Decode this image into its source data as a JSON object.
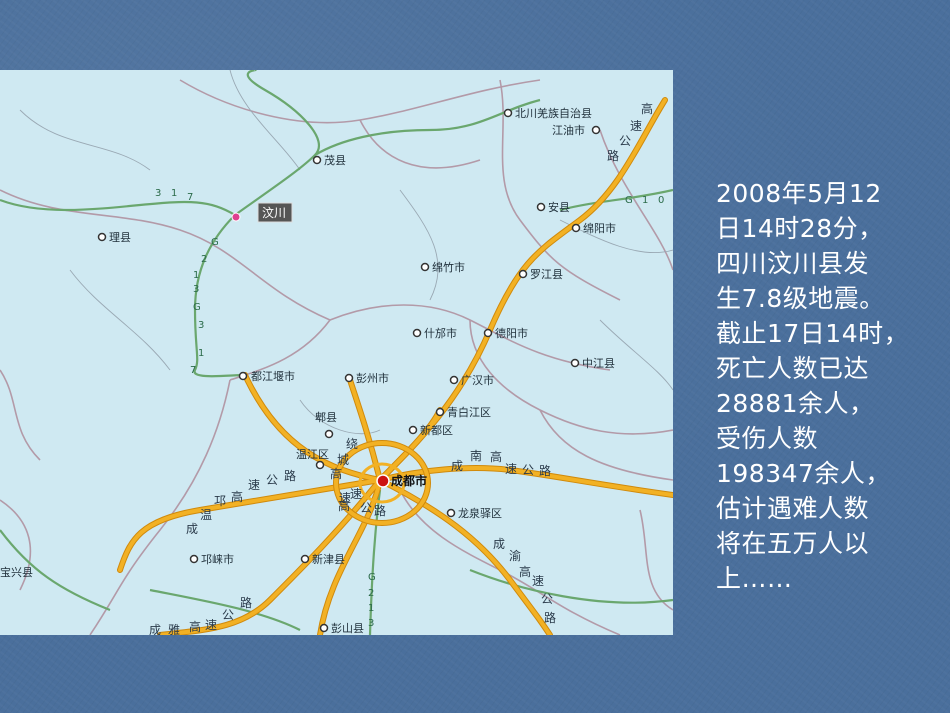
{
  "map": {
    "cities": [
      {
        "id": "beichuan",
        "label": "北川羌族自治县"
      },
      {
        "id": "jiangyou",
        "label": "江油市"
      },
      {
        "id": "maoxian",
        "label": "茂县"
      },
      {
        "id": "anxian",
        "label": "安县"
      },
      {
        "id": "mianyang",
        "label": "绵阳市"
      },
      {
        "id": "lixian",
        "label": "理县"
      },
      {
        "id": "mianzhu",
        "label": "绵竹市"
      },
      {
        "id": "luojiang",
        "label": "罗江县"
      },
      {
        "id": "shifang",
        "label": "什邡市"
      },
      {
        "id": "deyang",
        "label": "德阳市"
      },
      {
        "id": "zhongjiang",
        "label": "中江县"
      },
      {
        "id": "dujiangyan",
        "label": "都江堰市"
      },
      {
        "id": "pengzhou",
        "label": "彭州市"
      },
      {
        "id": "guanghan",
        "label": "广汉市"
      },
      {
        "id": "pixian",
        "label": "郫县"
      },
      {
        "id": "qingbaijiang",
        "label": "青白江区"
      },
      {
        "id": "xindu",
        "label": "新都区"
      },
      {
        "id": "wenjiang",
        "label": "温江区"
      },
      {
        "id": "chengdu",
        "label": "成都市"
      },
      {
        "id": "longquanyi",
        "label": "龙泉驿区"
      },
      {
        "id": "qionglai",
        "label": "邛崃市"
      },
      {
        "id": "xinjin",
        "label": "新津县"
      },
      {
        "id": "pengshan",
        "label": "彭山县"
      },
      {
        "id": "baoxing",
        "label": "宝兴县"
      }
    ],
    "epicenter": {
      "label": "汶川",
      "icon": "epicenter-marker-icon"
    },
    "road_labels": [
      {
        "id": "ring",
        "chars": [
          "绕",
          "城"
        ]
      },
      {
        "id": "chengnan",
        "chars": [
          "成",
          "南",
          "高",
          "速",
          "公",
          "路"
        ]
      },
      {
        "id": "chengwen",
        "chars": [
          "成",
          "温",
          "邛",
          "高",
          "速",
          "公",
          "路"
        ]
      },
      {
        "id": "chengya",
        "chars": [
          "成",
          "雅",
          "高",
          "速",
          "公",
          "路"
        ]
      },
      {
        "id": "chengyu",
        "chars": [
          "成",
          "渝",
          "高",
          "速",
          "公",
          "路"
        ]
      },
      {
        "id": "chengmian",
        "chars": [
          "高",
          "速",
          "公",
          "路"
        ]
      },
      {
        "id": "chengle",
        "chars": [
          "高",
          "速",
          "公",
          "路"
        ]
      },
      {
        "id": "airport",
        "chars": [
          "高",
          "速"
        ]
      }
    ],
    "road_codes": [
      {
        "id": "g317",
        "chars": [
          "3",
          "1",
          "7"
        ]
      },
      {
        "id": "g213",
        "chars": [
          "G",
          "2",
          "1",
          "3",
          "G",
          "3",
          "1",
          "7"
        ]
      },
      {
        "id": "g108",
        "chars": [
          "G",
          "1",
          "0"
        ]
      },
      {
        "id": "g213s",
        "chars": [
          "G",
          "2",
          "1",
          "3"
        ]
      }
    ],
    "colors": {
      "water_bg": "#cfe9f2",
      "highway": "#f2b124",
      "highway_edge": "#d08a0c",
      "national_road": "#6aa76e",
      "boundary": "#b39aa8",
      "city_dot": "#333333",
      "capital_dot": "#cc1111"
    }
  },
  "caption": {
    "lines": [
      "2008年5月12",
      "日14时28分，",
      "四川汶川县发",
      "生7.8级地震。",
      "截止17日14时，",
      "死亡人数已达",
      "28881余人，",
      "受伤人数",
      "198347余人，",
      "估计遇难人数",
      "将在五万人以",
      "上……"
    ]
  }
}
